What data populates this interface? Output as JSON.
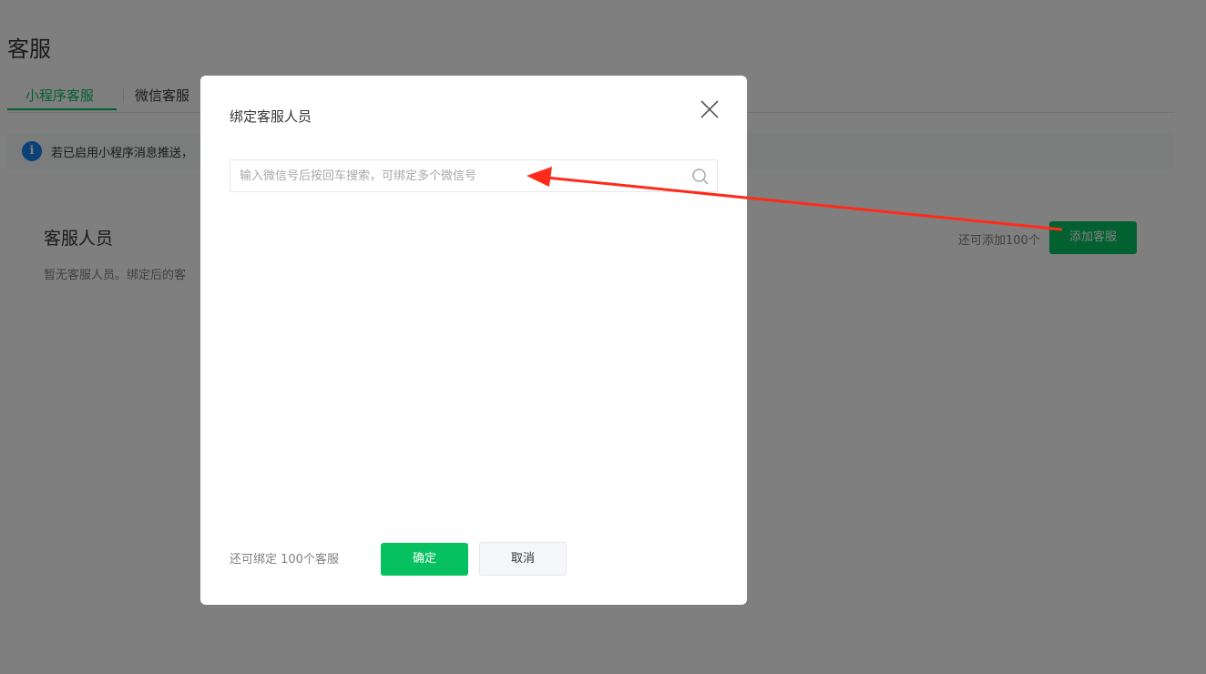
{
  "page": {
    "title": "客服",
    "tabs": [
      {
        "label": "小程序客服",
        "active": true
      },
      {
        "label": "微信客服",
        "active": false
      }
    ],
    "notice": {
      "icon": "info-icon",
      "text": "若已启用小程序消息推送，"
    },
    "staff_card": {
      "title": "客服人员",
      "description": "暂无客服人员。绑定后的客",
      "quota": "还可添加100个",
      "add_button": "添加客服"
    }
  },
  "dialog": {
    "title": "绑定客服人员",
    "close_icon": "close-icon",
    "search": {
      "placeholder": "输入微信号后按回车搜索，可绑定多个微信号",
      "value": "",
      "icon": "search-icon"
    },
    "footer": {
      "quota": "还可绑定 100个客服",
      "confirm": "确定",
      "cancel": "取消"
    }
  },
  "colors": {
    "brand_green": "#07c160",
    "info_blue": "#1485ee",
    "annotation_red": "#ff2a1a",
    "mask": "rgba(0,0,0,0.5)"
  }
}
